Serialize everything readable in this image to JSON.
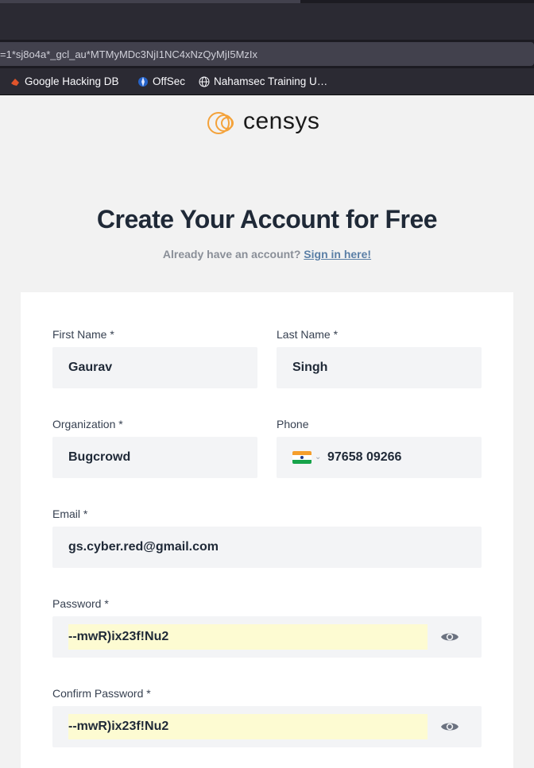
{
  "browser": {
    "url": "=1*sj8o4a*_gcl_au*MTMyMDc3NjI1NC4xNzQyMjI5MzIx",
    "bookmarks": [
      {
        "label": "Google Hacking DB",
        "icon": "exploit-db-icon"
      },
      {
        "label": "OffSec",
        "icon": "offsec-icon"
      },
      {
        "label": "Nahamsec Training U…",
        "icon": "globe-icon"
      }
    ]
  },
  "page": {
    "brand": "censys",
    "title": "Create Your Account for Free",
    "signin_prompt": "Already have an account?",
    "signin_link": "Sign in here!"
  },
  "form": {
    "first_name": {
      "label": "First Name *",
      "value": "Gaurav"
    },
    "last_name": {
      "label": "Last Name *",
      "value": "Singh"
    },
    "organization": {
      "label": "Organization *",
      "value": "Bugcrowd"
    },
    "phone": {
      "label": "Phone",
      "value": "97658 09266",
      "country_flag": "India"
    },
    "email": {
      "label": "Email *",
      "value": "gs.cyber.red@gmail.com"
    },
    "password": {
      "label": "Password *",
      "value": "--mwR)ix23f!Nu2"
    },
    "confirm_password": {
      "label": "Confirm Password *",
      "value": "--mwR)ix23f!Nu2"
    }
  },
  "colors": {
    "brand_orange": "#f4a23a",
    "link": "#5b7fa6",
    "autofill": "#fdfbd2"
  }
}
